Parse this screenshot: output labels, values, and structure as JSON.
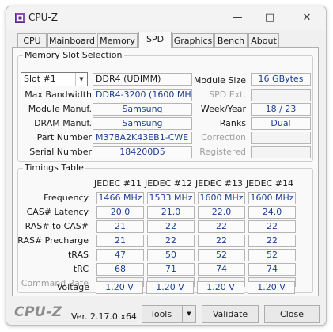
{
  "window": {
    "title": "CPU-Z"
  },
  "tabs": [
    {
      "label": "CPU"
    },
    {
      "label": "Mainboard"
    },
    {
      "label": "Memory"
    },
    {
      "label": "SPD"
    },
    {
      "label": "Graphics"
    },
    {
      "label": "Bench"
    },
    {
      "label": "About"
    }
  ],
  "slot": {
    "group_title": "Memory Slot Selection",
    "selected": "Slot #1",
    "type": "DDR4 (UDIMM)",
    "rows": [
      {
        "label": "Max Bandwidth",
        "value": "DDR4-3200 (1600 MHz)"
      },
      {
        "label": "Module Manuf.",
        "value": "Samsung"
      },
      {
        "label": "DRAM Manuf.",
        "value": "Samsung"
      },
      {
        "label": "Part Number",
        "value": "M378A2K43EB1-CWE"
      },
      {
        "label": "Serial Number",
        "value": "184200D5"
      }
    ],
    "right_rows": [
      {
        "label": "Module Size",
        "value": "16 GBytes"
      },
      {
        "label": "SPD Ext.",
        "value": ""
      },
      {
        "label": "Week/Year",
        "value": "18 / 23"
      },
      {
        "label": "Ranks",
        "value": "Dual"
      },
      {
        "label": "Correction",
        "value": ""
      },
      {
        "label": "Registered",
        "value": ""
      }
    ]
  },
  "timings": {
    "group_title": "Timings Table",
    "columns": [
      "JEDEC #11",
      "JEDEC #12",
      "JEDEC #13",
      "JEDEC #14"
    ],
    "rows": [
      {
        "label": "Frequency",
        "values": [
          "1466 MHz",
          "1533 MHz",
          "1600 MHz",
          "1600 MHz"
        ]
      },
      {
        "label": "CAS# Latency",
        "values": [
          "20.0",
          "21.0",
          "22.0",
          "24.0"
        ]
      },
      {
        "label": "RAS# to CAS#",
        "values": [
          "21",
          "22",
          "22",
          "22"
        ]
      },
      {
        "label": "RAS# Precharge",
        "values": [
          "21",
          "22",
          "22",
          "22"
        ]
      },
      {
        "label": "tRAS",
        "values": [
          "47",
          "50",
          "52",
          "52"
        ]
      },
      {
        "label": "tRC",
        "values": [
          "68",
          "71",
          "74",
          "74"
        ]
      },
      {
        "label": "Command Rate",
        "values": [
          "",
          "",
          "",
          ""
        ]
      },
      {
        "label": "Voltage",
        "values": [
          "1.20 V",
          "1.20 V",
          "1.20 V",
          "1.20 V"
        ]
      }
    ]
  },
  "footer": {
    "logo": "CPU-Z",
    "version": "Ver. 2.17.0.x64",
    "tools_label": "Tools",
    "validate_label": "Validate",
    "close_label": "Close"
  },
  "colors": {
    "value_text": "#1c3f94",
    "dim_label": "#a0a0a0",
    "panel": "#f9f9f9"
  }
}
